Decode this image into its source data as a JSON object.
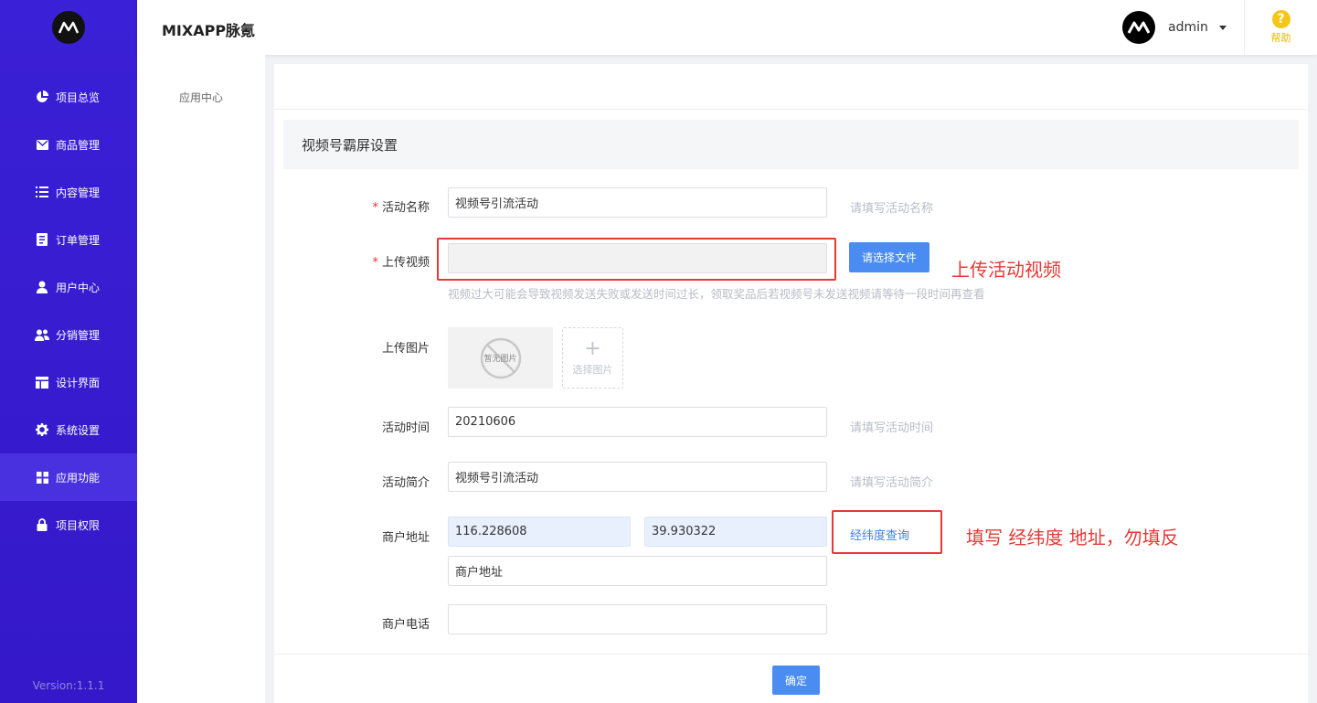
{
  "app": {
    "title": "MIXAPP脉氪",
    "version": "Version:1.1.1"
  },
  "sidebar": {
    "items": [
      {
        "label": "项目总览",
        "icon": "pie-chart-icon"
      },
      {
        "label": "商品管理",
        "icon": "mail-icon"
      },
      {
        "label": "内容管理",
        "icon": "list-icon"
      },
      {
        "label": "订单管理",
        "icon": "document-icon"
      },
      {
        "label": "用户中心",
        "icon": "user-icon"
      },
      {
        "label": "分销管理",
        "icon": "users-icon"
      },
      {
        "label": "设计界面",
        "icon": "layout-icon"
      },
      {
        "label": "系统设置",
        "icon": "gear-icon"
      },
      {
        "label": "应用功能",
        "icon": "grid-icon"
      },
      {
        "label": "项目权限",
        "icon": "lock-icon"
      }
    ],
    "active_index": 8
  },
  "header": {
    "username": "admin",
    "help_label": "帮助",
    "help_glyph": "?"
  },
  "subnav": {
    "item": "应用中心"
  },
  "section": {
    "title": "视频号霸屏设置"
  },
  "form": {
    "activity_name": {
      "label": "活动名称",
      "value": "视频号引流活动",
      "hint": "请填写活动名称"
    },
    "video": {
      "label": "上传视频",
      "button": "请选择文件",
      "note": "视频过大可能会导致视频发送失败或发送时间过长，领取奖品后若视频号未发送视频请等待一段时间再查看"
    },
    "image": {
      "label": "上传图片",
      "placeholder": "暂无图片",
      "select": "选择图片",
      "plus": "+"
    },
    "activity_time": {
      "label": "活动时间",
      "value": "20210606",
      "hint": "请填写活动时间"
    },
    "activity_intro": {
      "label": "活动简介",
      "value": "视频号引流活动",
      "hint": "请填写活动简介"
    },
    "merchant_address": {
      "label": "商户地址",
      "longitude": "116.228608",
      "latitude": "39.930322",
      "link": "经纬度查询",
      "address": "商户地址"
    },
    "merchant_phone": {
      "label": "商户电话",
      "value": ""
    },
    "required_mark": "*"
  },
  "annotations": {
    "video": "上传活动视频",
    "address": "填写 经纬度 地址，勿填反"
  },
  "footer": {
    "confirm": "确定"
  }
}
